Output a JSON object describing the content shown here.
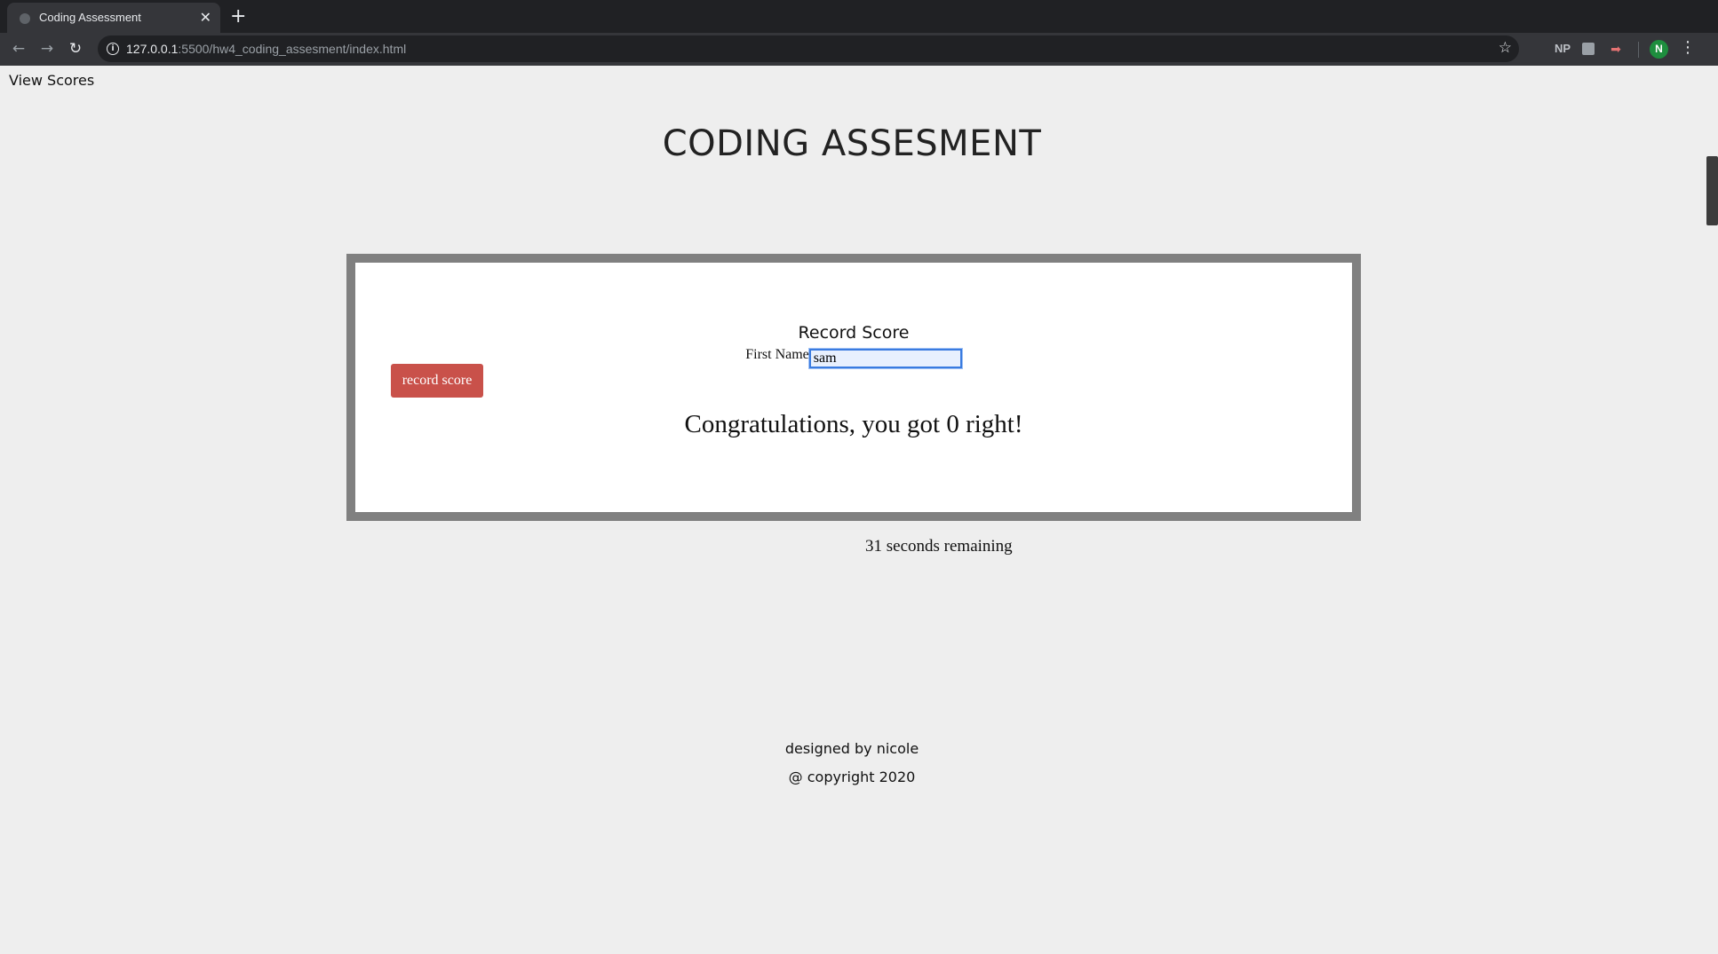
{
  "browser": {
    "tab_title": "Coding Assessment",
    "tab_close": "✕",
    "new_tab": "+",
    "url_host": "127.0.0.1",
    "url_rest": ":5500/hw4_coding_assesment/index.html",
    "back": "←",
    "forward": "→",
    "reload": "↻",
    "star": "☆",
    "extension_np": "NP",
    "extension_arrow": "➡",
    "avatar_initial": "N",
    "menu": "⋮"
  },
  "nav": {
    "view_scores": "View Scores"
  },
  "header": {
    "title": "CODING ASSESMENT"
  },
  "quiz": {
    "record_heading": "Record Score",
    "first_name_label": "First Name",
    "first_name_value": "sam",
    "record_button": "record score",
    "result_message": "Congratulations, you got 0 right!"
  },
  "timer": {
    "text": "31 seconds remaining"
  },
  "footer": {
    "designed_by": "designed by nicole",
    "copyright": "@ copyright 2020"
  }
}
